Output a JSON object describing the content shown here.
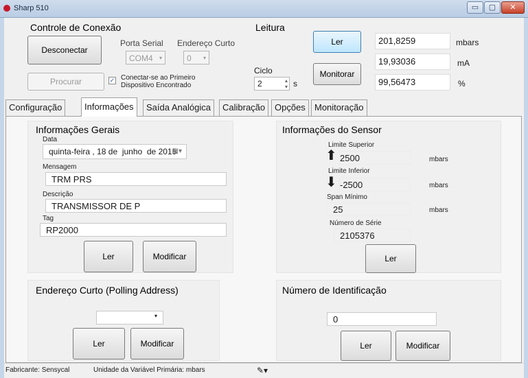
{
  "window": {
    "title": "Sharp 510",
    "minimize": "▭",
    "maximize": "▢",
    "close": "✕"
  },
  "connection": {
    "group_title": "Controle de Conexão",
    "disconnect_label": "Desconectar",
    "search_label": "Procurar",
    "serial_port_label": "Porta Serial",
    "serial_port_value": "COM4",
    "short_address_label": "Endereço Curto",
    "short_address_value": "0",
    "connect_first_label_line1": "Conectar-se ao Primeiro",
    "connect_first_label_line2": "Dispositivo Encontrado",
    "connect_first_checked": true
  },
  "reading": {
    "group_title": "Leitura",
    "read_label": "Ler",
    "monitor_label": "Monitorar",
    "cycle_label": "Ciclo",
    "cycle_value": "2",
    "cycle_unit": "s",
    "values": [
      {
        "value": "201,8259",
        "unit": "mbars"
      },
      {
        "value": "19,93036",
        "unit": "mA"
      },
      {
        "value": "99,56473",
        "unit": "%"
      }
    ]
  },
  "tabs": [
    {
      "label": "Configuração",
      "active": false
    },
    {
      "label": "Informações",
      "active": true
    },
    {
      "label": "Saída Analógica",
      "active": false
    },
    {
      "label": "Calibração",
      "active": false
    },
    {
      "label": "Opções",
      "active": false
    },
    {
      "label": "Monitoração",
      "active": false
    }
  ],
  "general_info": {
    "title": "Informações Gerais",
    "date_label": "Data",
    "date_value": {
      "weekday": "quinta-feira",
      "sep1": ",",
      "day": "18",
      "de1": "de",
      "month": "junho",
      "de2": "de",
      "year": "2015"
    },
    "message_label": "Mensagem",
    "message_value": "TRM PRS",
    "description_label": "Descrição",
    "description_value": "TRANSMISSOR DE P",
    "tag_label": "Tag",
    "tag_value": "RP2000",
    "read_label": "Ler",
    "modify_label": "Modificar"
  },
  "sensor_info": {
    "title": "Informações do Sensor",
    "upper_limit_label": "Limite Superior",
    "upper_limit_value": "2500",
    "upper_limit_unit": "mbars",
    "lower_limit_label": "Limite Inferior",
    "lower_limit_value": "-2500",
    "lower_limit_unit": "mbars",
    "min_span_label": "Span Mínimo",
    "min_span_value": "25",
    "min_span_unit": "mbars",
    "serial_number_label": "Número de Série",
    "serial_number_value": "2105376",
    "read_label": "Ler"
  },
  "polling": {
    "title": "Endereço Curto (Polling Address)",
    "read_label": "Ler",
    "modify_label": "Modificar"
  },
  "ident": {
    "title": "Número de Identificação",
    "value": "0",
    "read_label": "Ler",
    "modify_label": "Modificar"
  },
  "status": {
    "manufacturer": "Fabricante: Sensycal",
    "primary_unit": "Unidade da Variável Primária: mbars"
  }
}
